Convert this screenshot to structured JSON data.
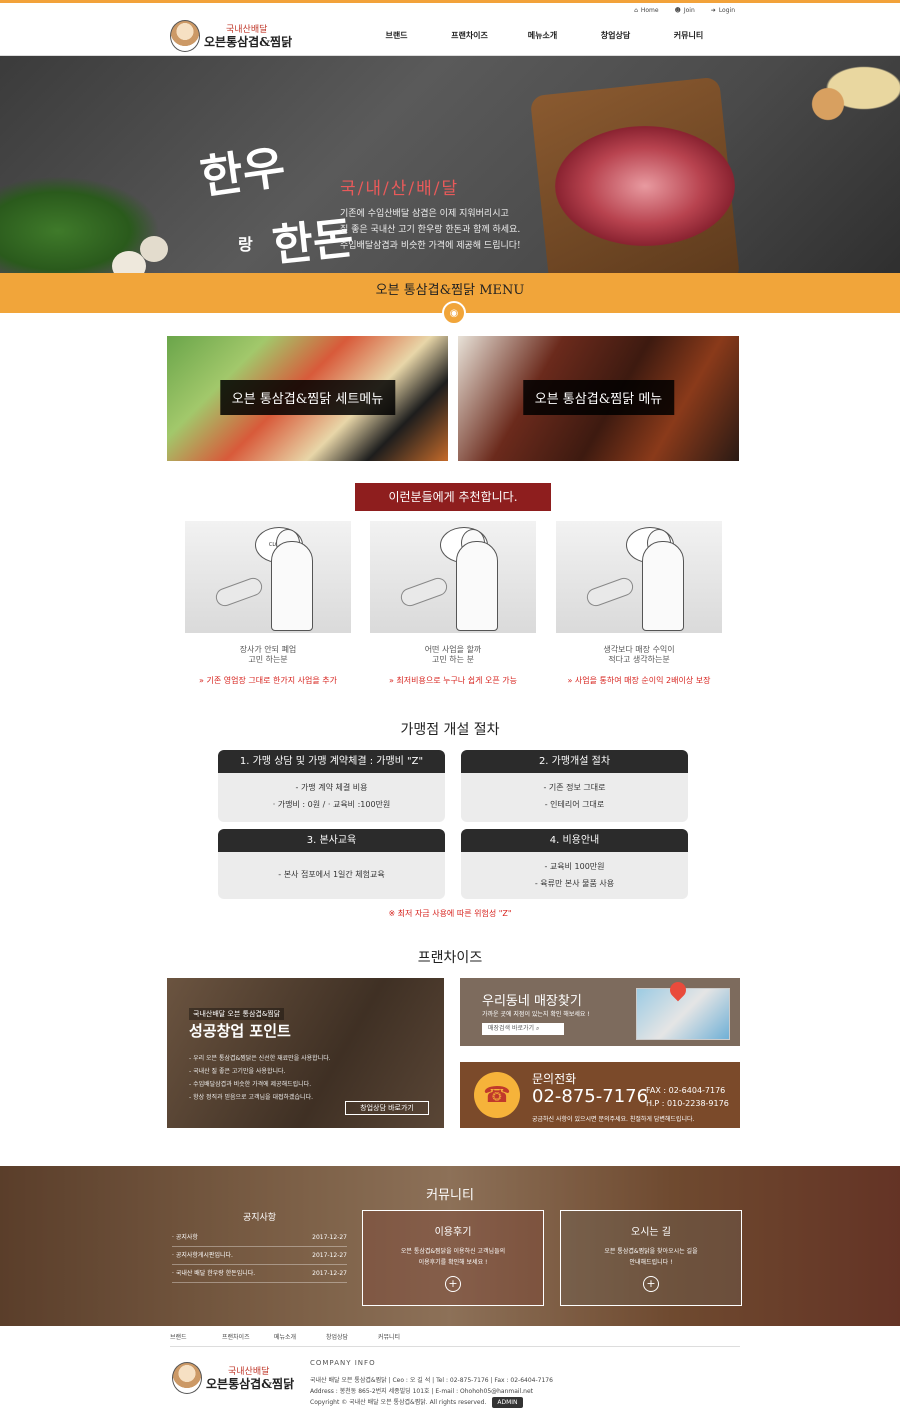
{
  "topbar": {
    "home": "Home",
    "join": "Join",
    "login": "Login"
  },
  "logo": {
    "line1": "국내산배달",
    "line2": "오븐통삼겹&찜닭"
  },
  "nav": [
    "브랜드",
    "프랜차이즈",
    "메뉴소개",
    "창업상담",
    "커뮤니티"
  ],
  "hero": {
    "calli_1": "한우",
    "calli_small": "랑",
    "calli_2": "한돈",
    "subtitle": "국/내/산/배/달",
    "desc_1": "기존에 수입산배달 삼겹은 이제 지워버리시고",
    "desc_2": "질 좋은 국내산 고기 한우랑 한돈과 함께 하세요.",
    "desc_3": "수입배달삼겹과 비슷한 가격에 제공해 드립니다!"
  },
  "menu_band": {
    "title": "오븐 통삼겹&찜닭 MENU"
  },
  "banners": {
    "set": "오븐 통삼겹&찜닭 세트메뉴",
    "menu": "오븐 통삼겹&찜닭 메뉴"
  },
  "recommend": {
    "title": "이런분들에게 추천합니다.",
    "items": [
      {
        "cap1": "장사가 안되 폐업",
        "cap2": "고민 하는분",
        "note": "기존 영업장 그대로 한가지 사업을 추가",
        "bubble": "CLOSED"
      },
      {
        "cap1": "어떤 사업을 할까",
        "cap2": "고민 하는 분",
        "note": "최저비용으로 누구나 쉽게 오픈 가능",
        "bubble": ""
      },
      {
        "cap1": "생각보다 매장 수익이",
        "cap2": "적다고 생각하는분",
        "note": "사업을 통하여 매장 순이익 2배이상 보장",
        "bubble": ""
      }
    ]
  },
  "procedure": {
    "title": "가맹점 개설 절차",
    "steps": [
      {
        "head": "1. 가맹 상담 및 가맹 계약체결 : 가맹비 \"Z\"",
        "lines": [
          "- 가맹 계약 체결 비용",
          "· 가맹비 : 0원 / · 교육비 :100만원"
        ]
      },
      {
        "head": "2. 가맹개설 절차",
        "lines": [
          "- 기존 정보 그대로",
          "- 인테리어 그대로"
        ]
      },
      {
        "head": "3. 본사교육",
        "lines": [
          "- 본사 접포에서 1일간 체험교육",
          ""
        ]
      },
      {
        "head": "4. 비용안내",
        "lines": [
          "- 교육비 100만원",
          "- 육류만 본사 물품 사용"
        ]
      }
    ],
    "note": "※ 최저 자금 사용에 따른 위험성 \"Z\""
  },
  "franchise": {
    "title": "프랜차이즈",
    "left": {
      "tag": "국내산배달 오븐 통삼겹&찜닭",
      "heading": "성공창업 포인트",
      "points": [
        "- 우리 오븐 통삼겹&찜닭은 신선한 재료만을 사용합니다.",
        "- 국내산 질 좋은 고기만을 사용합니다.",
        "- 수입배달삼겹과 비슷한 가격에 제공해드립니다.",
        "- 항상 정직과 믿음으로 고객님을 대접하겠습니다."
      ],
      "button": "창업상담 바로가기"
    },
    "store": {
      "title": "우리동네 매장찾기",
      "sub": "가까운 곳에 지점이 있는지 확인 해보세요 !",
      "search": "매장검색 바로가기"
    },
    "call": {
      "title": "문의전화",
      "number": "02-875-7176",
      "fax": "FAX : 02-6404-7176",
      "hp": "H.P : 010-2238-9176",
      "sub": "궁금하신 사항이 있으시면 문의주세요. 친절하게 답변해드립니다."
    }
  },
  "community": {
    "title": "커뮤니티",
    "notice_title": "공지사항",
    "notices": [
      {
        "text": "· 공지사항",
        "date": "2017-12-27"
      },
      {
        "text": "· 공지사항게시판입니다.",
        "date": "2017-12-27"
      },
      {
        "text": "· 국내산 배달 한우랑 한돈입니다.",
        "date": "2017-12-27"
      }
    ],
    "review": {
      "title": "이용후기",
      "d1": "오븐 통삼겹&찜닭을 이용하신 고객님들의",
      "d2": "이용후기를 확인해 보세요 !"
    },
    "map": {
      "title": "오시는 길",
      "d1": "오븐 통삼겹&찜닭을 찾아오시는 길을",
      "d2": "안내해드립니다 !"
    },
    "plus": "+"
  },
  "footer": {
    "nav": [
      "브랜드",
      "프랜차이즈",
      "메뉴소개",
      "창업상담",
      "커뮤니티"
    ],
    "company_title": "COMPANY INFO",
    "line1": "국내산 배달 오븐 통삼겹&찜닭 | Ceo : 오 길 석 | Tel : 02-875-7176 | Fax : 02-6404-7176",
    "line2": "Address : 봉천동 865-2번지 세종빌딩 101호 | E-mail : Ohohoh05@hanmail.net",
    "line3": "Copyright © 국내산 배달 오븐 통삼겹&찜닭. All rights reserved.",
    "admin": "ADMIN"
  }
}
